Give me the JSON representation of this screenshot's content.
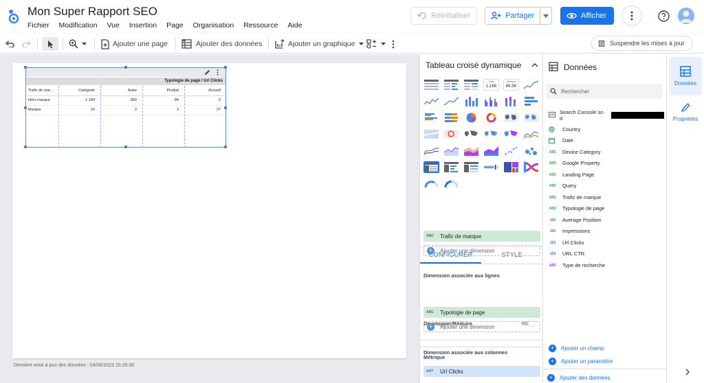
{
  "header": {
    "title": "Mon Super Rapport SEO",
    "menu": [
      "Fichier",
      "Modification",
      "Vue",
      "Insertion",
      "Page",
      "Organisation",
      "Ressource",
      "Aide"
    ],
    "reset_label": "Réinitialiser",
    "share_label": "Partager",
    "view_label": "Afficher"
  },
  "toolbar": {
    "add_page": "Ajouter une page",
    "add_data": "Ajouter des données",
    "add_chart": "Ajouter un graphique",
    "suspend": "Suspendre les mises à jour"
  },
  "canvas": {
    "last_update": "Dernière mise à jour des données : 04/06/2023 15:26:30",
    "pivot": {
      "column_dimension_header": "Typologie de page / Url Clicks",
      "row_dimension_header": "Trafic de mar...",
      "columns": [
        "Catégorie",
        "Autre",
        "Produit",
        "Accueil"
      ],
      "rows": [
        {
          "label": "Hors marque",
          "values": [
            "1 184",
            "950",
            "84",
            "0"
          ]
        },
        {
          "label": "Marque",
          "values": [
            "10",
            "2",
            "2",
            "27"
          ]
        }
      ]
    }
  },
  "chart_panel": {
    "title": "Tableau croisé dynamique",
    "scorecard_1": {
      "label": "Total",
      "value": "1,168"
    },
    "scorecard_2": {
      "label": "Sessions",
      "value": "69.3K"
    },
    "tab_configure": "CONFIGURER",
    "tab_style": "STYLE",
    "row_dim_label": "Dimension associée aux lignes",
    "row_dim_chip": "Trafic de marque",
    "row_dim_chip_type": "ABC",
    "add_dimension": "Ajouter une dimension",
    "expand_label": "Développer/Réduire",
    "col_dim_label": "Dimension associée aux colonnes",
    "col_dim_chip": "Typologie de page",
    "col_dim_chip_type": "ABC",
    "metric_label": "Métrique",
    "metric_chip": "Url Clicks",
    "metric_chip_type": "AUT",
    "accent": "#1a73e8",
    "dimension_chip_color": "#ceead6",
    "metric_chip_color": "#d2e3fc"
  },
  "data_panel": {
    "title": "Données",
    "search_placeholder": "Rechercher",
    "source": "Search Console sc-d",
    "fields": [
      {
        "type": "geo",
        "name": "Country"
      },
      {
        "type": "date",
        "name": "Date"
      },
      {
        "type": "ABC",
        "name": "Device Category"
      },
      {
        "type": "ABC",
        "name": "Google Property"
      },
      {
        "type": "ABC",
        "name": "Landing Page"
      },
      {
        "type": "ABC",
        "name": "Query"
      },
      {
        "type": "ABC",
        "name": "Trafic de marque"
      },
      {
        "type": "ABC",
        "name": "Typologie de page"
      },
      {
        "type": "123",
        "name": "Average Position"
      },
      {
        "type": "123",
        "name": "Impressions"
      },
      {
        "type": "123",
        "name": "Url Clicks"
      },
      {
        "type": "123",
        "name": "URL CTR"
      },
      {
        "type": "ABC",
        "name": "Type de recherche"
      }
    ],
    "add_field": "Ajouter un champ",
    "add_param": "Ajouter un paramètre",
    "add_data": "Ajouter des données"
  },
  "rail": {
    "data_label": "Données",
    "props_label": "Propriétés"
  }
}
